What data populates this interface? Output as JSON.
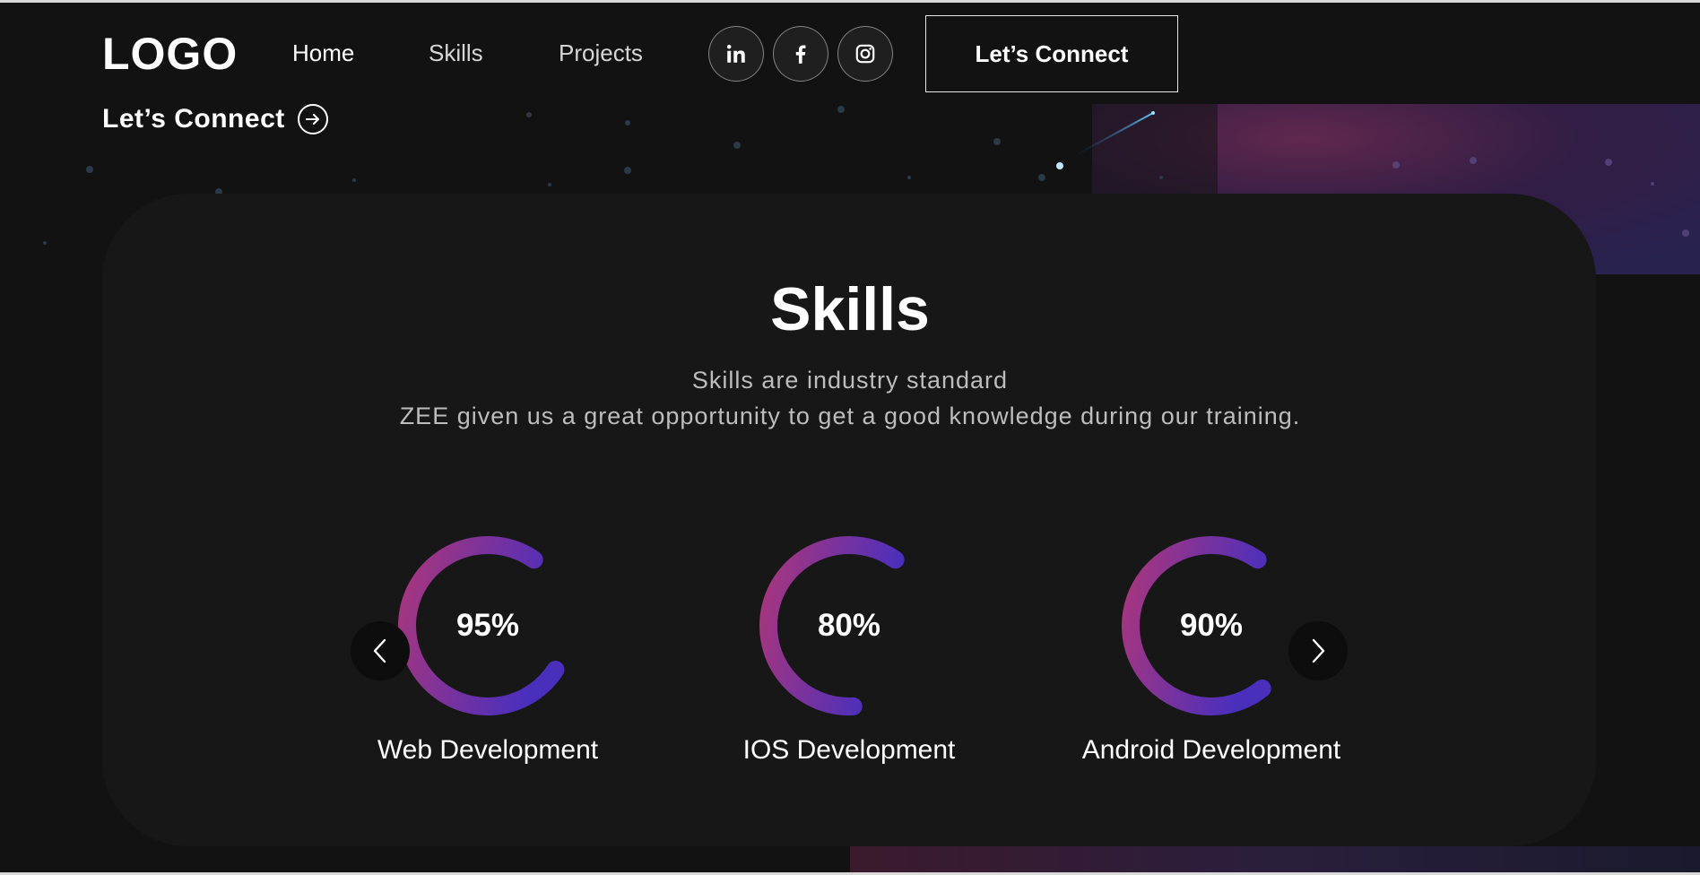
{
  "header": {
    "logo": "LOGO",
    "nav": [
      {
        "label": "Home"
      },
      {
        "label": "Skills"
      },
      {
        "label": "Projects"
      }
    ],
    "socials": [
      {
        "icon": "linkedin-icon"
      },
      {
        "icon": "facebook-icon"
      },
      {
        "icon": "instagram-icon"
      }
    ],
    "connect_button": "Let’s Connect"
  },
  "banner": {
    "connect_link": "Let’s Connect",
    "connect_icon": "arrow-right-circle-icon"
  },
  "skills": {
    "title": "Skills",
    "subtitle_line1": "Skills are industry standard",
    "subtitle_line2": "ZEE given us a great opportunity to get a good knowledge during our training.",
    "items": [
      {
        "label": "Web Development",
        "percent_text": "95%",
        "percent": 95
      },
      {
        "label": "IOS Development",
        "percent_text": "80%",
        "percent": 80
      },
      {
        "label": "Android Development",
        "percent_text": "90%",
        "percent": 90
      }
    ],
    "prev_icon": "chevron-left-icon",
    "next_icon": "chevron-right-icon"
  },
  "colors": {
    "background": "#121212",
    "card": "#171718",
    "gradient_start": "#aa367c",
    "gradient_end": "#4a2fbd"
  }
}
